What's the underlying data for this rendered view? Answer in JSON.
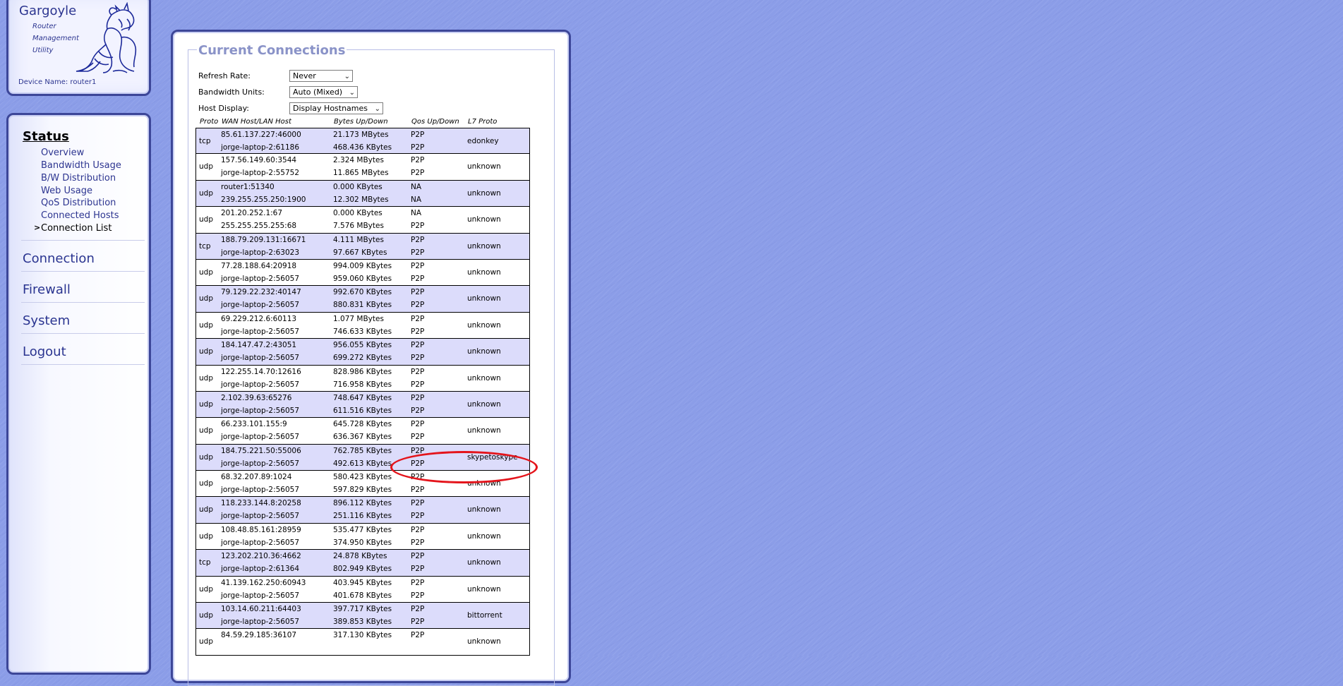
{
  "logo": {
    "title": "Gargoyle",
    "subtitle_lines": [
      "Router",
      "Management",
      "Utility"
    ],
    "device_name": "Device Name: router1"
  },
  "nav": {
    "active_section": "Status",
    "status_items": [
      "Overview",
      "Bandwidth Usage",
      "B/W Distribution",
      "Web Usage",
      "QoS Distribution",
      "Connected Hosts",
      "Connection List"
    ],
    "current_item_marker": ">",
    "sections": [
      "Connection",
      "Firewall",
      "System",
      "Logout"
    ]
  },
  "panel": {
    "title": "Current Connections",
    "refresh_rate": {
      "label": "Refresh Rate:",
      "value": "Never"
    },
    "bandwidth_units": {
      "label": "Bandwidth Units:",
      "value": "Auto (Mixed)"
    },
    "host_display": {
      "label": "Host Display:",
      "value": "Display Hostnames"
    }
  },
  "table": {
    "headers": [
      "Proto",
      "WAN Host/LAN Host",
      "Bytes Up/Down",
      "Qos Up/Down",
      "L7 Proto"
    ],
    "rows": [
      {
        "proto": "tcp",
        "wan": "85.61.137.227:46000",
        "lan": "jorge-laptop-2:61186",
        "up": "21.173 MBytes",
        "down": "468.436 KBytes",
        "qos_up": "P2P",
        "qos_down": "P2P",
        "l7": "edonkey"
      },
      {
        "proto": "udp",
        "wan": "157.56.149.60:3544",
        "lan": "jorge-laptop-2:55752",
        "up": "2.324 MBytes",
        "down": "11.865 MBytes",
        "qos_up": "P2P",
        "qos_down": "P2P",
        "l7": "unknown"
      },
      {
        "proto": "udp",
        "wan": "router1:51340",
        "lan": "239.255.255.250:1900",
        "up": "0.000 KBytes",
        "down": "12.302 MBytes",
        "qos_up": "NA",
        "qos_down": "NA",
        "l7": "unknown"
      },
      {
        "proto": "udp",
        "wan": "201.20.252.1:67",
        "lan": "255.255.255.255:68",
        "up": "0.000 KBytes",
        "down": "7.576 MBytes",
        "qos_up": "NA",
        "qos_down": "P2P",
        "l7": "unknown"
      },
      {
        "proto": "tcp",
        "wan": "188.79.209.131:16671",
        "lan": "jorge-laptop-2:63023",
        "up": "4.111 MBytes",
        "down": "97.667 KBytes",
        "qos_up": "P2P",
        "qos_down": "P2P",
        "l7": "unknown"
      },
      {
        "proto": "udp",
        "wan": "77.28.188.64:20918",
        "lan": "jorge-laptop-2:56057",
        "up": "994.009 KBytes",
        "down": "959.060 KBytes",
        "qos_up": "P2P",
        "qos_down": "P2P",
        "l7": "unknown"
      },
      {
        "proto": "udp",
        "wan": "79.129.22.232:40147",
        "lan": "jorge-laptop-2:56057",
        "up": "992.670 KBytes",
        "down": "880.831 KBytes",
        "qos_up": "P2P",
        "qos_down": "P2P",
        "l7": "unknown"
      },
      {
        "proto": "udp",
        "wan": "69.229.212.6:60113",
        "lan": "jorge-laptop-2:56057",
        "up": "1.077 MBytes",
        "down": "746.633 KBytes",
        "qos_up": "P2P",
        "qos_down": "P2P",
        "l7": "unknown"
      },
      {
        "proto": "udp",
        "wan": "184.147.47.2:43051",
        "lan": "jorge-laptop-2:56057",
        "up": "956.055 KBytes",
        "down": "699.272 KBytes",
        "qos_up": "P2P",
        "qos_down": "P2P",
        "l7": "unknown"
      },
      {
        "proto": "udp",
        "wan": "122.255.14.70:12616",
        "lan": "jorge-laptop-2:56057",
        "up": "828.986 KBytes",
        "down": "716.958 KBytes",
        "qos_up": "P2P",
        "qos_down": "P2P",
        "l7": "unknown"
      },
      {
        "proto": "udp",
        "wan": "2.102.39.63:65276",
        "lan": "jorge-laptop-2:56057",
        "up": "748.647 KBytes",
        "down": "611.516 KBytes",
        "qos_up": "P2P",
        "qos_down": "P2P",
        "l7": "unknown"
      },
      {
        "proto": "udp",
        "wan": "66.233.101.155:9",
        "lan": "jorge-laptop-2:56057",
        "up": "645.728 KBytes",
        "down": "636.367 KBytes",
        "qos_up": "P2P",
        "qos_down": "P2P",
        "l7": "unknown"
      },
      {
        "proto": "udp",
        "wan": "184.75.221.50:55006",
        "lan": "jorge-laptop-2:56057",
        "up": "762.785 KBytes",
        "down": "492.613 KBytes",
        "qos_up": "P2P",
        "qos_down": "P2P",
        "l7": "skypetoskype"
      },
      {
        "proto": "udp",
        "wan": "68.32.207.89:1024",
        "lan": "jorge-laptop-2:56057",
        "up": "580.423 KBytes",
        "down": "597.829 KBytes",
        "qos_up": "P2P",
        "qos_down": "P2P",
        "l7": "unknown"
      },
      {
        "proto": "udp",
        "wan": "118.233.144.8:20258",
        "lan": "jorge-laptop-2:56057",
        "up": "896.112 KBytes",
        "down": "251.116 KBytes",
        "qos_up": "P2P",
        "qos_down": "P2P",
        "l7": "unknown"
      },
      {
        "proto": "udp",
        "wan": "108.48.85.161:28959",
        "lan": "jorge-laptop-2:56057",
        "up": "535.477 KBytes",
        "down": "374.950 KBytes",
        "qos_up": "P2P",
        "qos_down": "P2P",
        "l7": "unknown"
      },
      {
        "proto": "tcp",
        "wan": "123.202.210.36:4662",
        "lan": "jorge-laptop-2:61364",
        "up": "24.878 KBytes",
        "down": "802.949 KBytes",
        "qos_up": "P2P",
        "qos_down": "P2P",
        "l7": "unknown"
      },
      {
        "proto": "udp",
        "wan": "41.139.162.250:60943",
        "lan": "jorge-laptop-2:56057",
        "up": "403.945 KBytes",
        "down": "401.678 KBytes",
        "qos_up": "P2P",
        "qos_down": "P2P",
        "l7": "unknown"
      },
      {
        "proto": "udp",
        "wan": "103.14.60.211:64403",
        "lan": "jorge-laptop-2:56057",
        "up": "397.717 KBytes",
        "down": "389.853 KBytes",
        "qos_up": "P2P",
        "qos_down": "P2P",
        "l7": "bittorrent"
      },
      {
        "proto": "udp",
        "wan": "84.59.29.185:36107",
        "lan": "",
        "up": "317.130 KBytes",
        "down": "",
        "qos_up": "P2P",
        "qos_down": "",
        "l7": "unknown"
      }
    ]
  },
  "annotation": {
    "highlighted_row": 12,
    "color": "#e4141b"
  },
  "colors": {
    "background": "#8b9de8",
    "border": "#3c4698",
    "link": "#2d3590",
    "row_alt": "#dcdcfb"
  }
}
